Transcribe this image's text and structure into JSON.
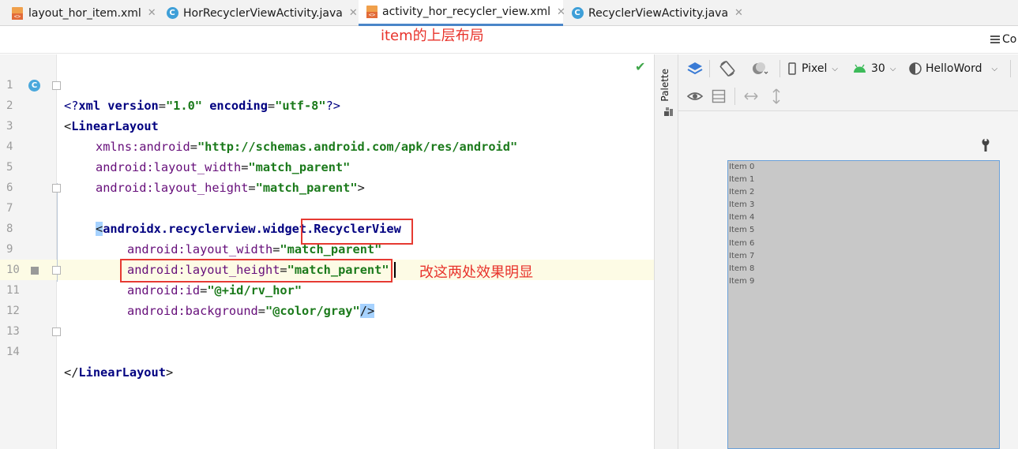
{
  "tabs": [
    {
      "label": "layout_hor_item.xml",
      "icon": "xml-file-icon",
      "active": false
    },
    {
      "label": "HorRecyclerViewActivity.java",
      "icon": "java-class-icon",
      "active": false
    },
    {
      "label": "activity_hor_recycler_view.xml",
      "icon": "xml-file-icon",
      "active": true
    },
    {
      "label": "RecyclerViewActivity.java",
      "icon": "java-class-icon",
      "active": false
    }
  ],
  "tab_close_glyph": "✕",
  "annotation_top": "item的上层布局",
  "annotation_mid": "改这两处效果明显",
  "mode_label": "Co",
  "editor": {
    "line_numbers": [
      "1",
      "2",
      "3",
      "4",
      "5",
      "6",
      "7",
      "8",
      "9",
      "10",
      "11",
      "12",
      "13",
      "14"
    ],
    "lines": {
      "l1": {
        "a": "<?",
        "b": "xml ",
        "c": "version",
        "d": "=",
        "e": "\"1.0\"",
        "f": " encoding",
        "g": "=",
        "h": "\"utf-8\"",
        "i": "?>"
      },
      "l2": {
        "a": "<",
        "b": "LinearLayout"
      },
      "l3": {
        "a": "xmlns:android",
        "b": "=",
        "c": "\"http://schemas.android.com/apk/res/android\""
      },
      "l4": {
        "a": "android:layout_width",
        "b": "=",
        "c": "\"match_parent\""
      },
      "l5": {
        "a": "android:layout_height",
        "b": "=",
        "c": "\"match_parent\"",
        "d": ">"
      },
      "l7": {
        "a": "<",
        "b": "androidx.recyclerview.widget.RecyclerView"
      },
      "l8": {
        "a": "android:layout_width",
        "b": "=",
        "c": "\"match_parent\""
      },
      "l9": {
        "a": "android:layout_height",
        "b": "=",
        "c": "\"match_parent\""
      },
      "l10": {
        "a": "android:id",
        "b": "=",
        "c": "\"@+id/rv_hor\""
      },
      "l11": {
        "a": "android:background",
        "b": "=",
        "c": "\"@color/gray\"",
        "d": "/>"
      },
      "l14": {
        "a": "</",
        "b": "LinearLayout",
        "c": ">"
      }
    },
    "check_glyph": "✔",
    "gutter_class_badge": "C"
  },
  "palette_label": "Palette",
  "design": {
    "device_label": "Pixel",
    "api_level": "30",
    "theme_label": "HelloWord",
    "preview_items": [
      "Item 0",
      "Item 1",
      "Item 2",
      "Item 3",
      "Item 4",
      "Item 5",
      "Item 6",
      "Item 7",
      "Item 8",
      "Item 9"
    ]
  },
  "colors": {
    "accent_tab_underline": "#4a86c8",
    "annotation_red": "#e8332b",
    "preview_background": "#c8c8c8"
  }
}
